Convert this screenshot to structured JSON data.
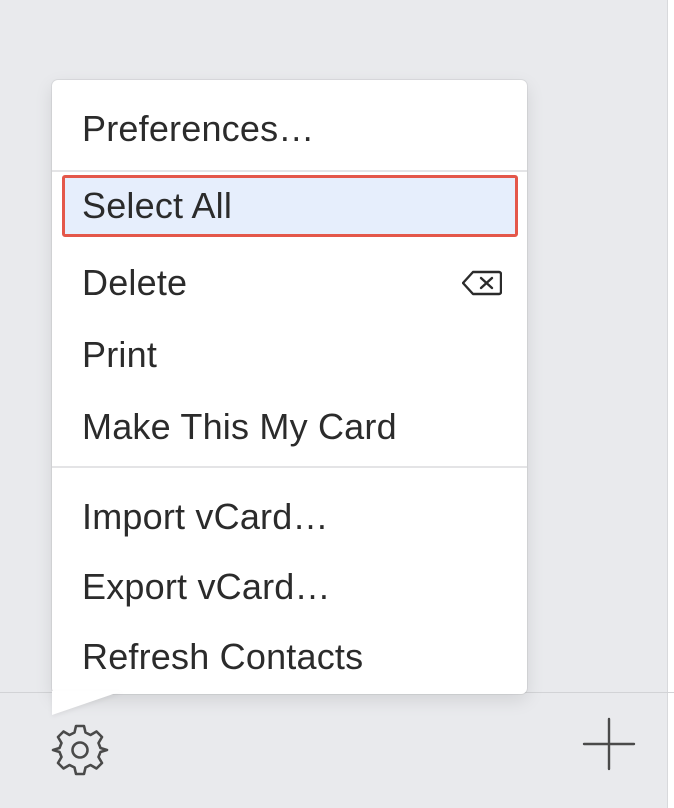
{
  "menu": {
    "items": [
      {
        "label": "Preferences…"
      },
      {
        "label": "Select All",
        "selected": true
      },
      {
        "label": "Delete",
        "shortcut": "delete-key-icon"
      },
      {
        "label": "Print"
      },
      {
        "label": "Make This My Card"
      },
      {
        "label": "Import vCard…"
      },
      {
        "label": "Export vCard…"
      },
      {
        "label": "Refresh Contacts"
      }
    ]
  },
  "toolbar": {
    "action_icon": "gear-icon",
    "add_icon": "plus-icon"
  },
  "colors": {
    "highlight_border": "#e4574a",
    "highlight_fill": "#e6eefc",
    "menu_bg": "#ffffff",
    "window_bg": "#e9eaed"
  }
}
